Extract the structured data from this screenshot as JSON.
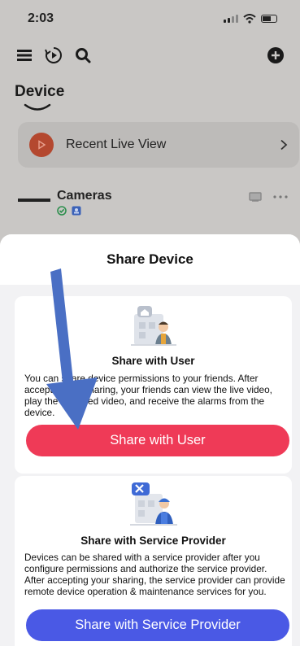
{
  "status_bar": {
    "time": "2:03"
  },
  "app": {
    "page_title": "Device",
    "recent": {
      "label": "Recent Live View"
    },
    "cameras": {
      "label": "Cameras"
    },
    "icons": [
      "menu-icon",
      "playback-icon",
      "search-icon",
      "add-icon",
      "chevron-right-icon",
      "online-check-icon",
      "cloud-badge-icon",
      "screen-icon",
      "more-icon"
    ]
  },
  "sheet": {
    "title": "Share Device",
    "share_user": {
      "title": "Share with User",
      "description": "You can share device permissions to your friends. After accepting the sharing, your friends can view the live video, play the recorded video, and receive the alarms from the device.",
      "button": "Share with User"
    },
    "share_provider": {
      "title": "Share with Service Provider",
      "description": "Devices can be shared with a service provider after you configure permissions and authorize the service provider. After accepting your sharing, the service provider can provide remote device operation & maintenance services for you.",
      "button": "Share with Service Provider"
    }
  },
  "colors": {
    "share_user_button": "#ef3a57",
    "share_provider_button": "#4a59e5",
    "annotation_arrow": "#4a6fc4",
    "recent_play": "#b4482f"
  }
}
